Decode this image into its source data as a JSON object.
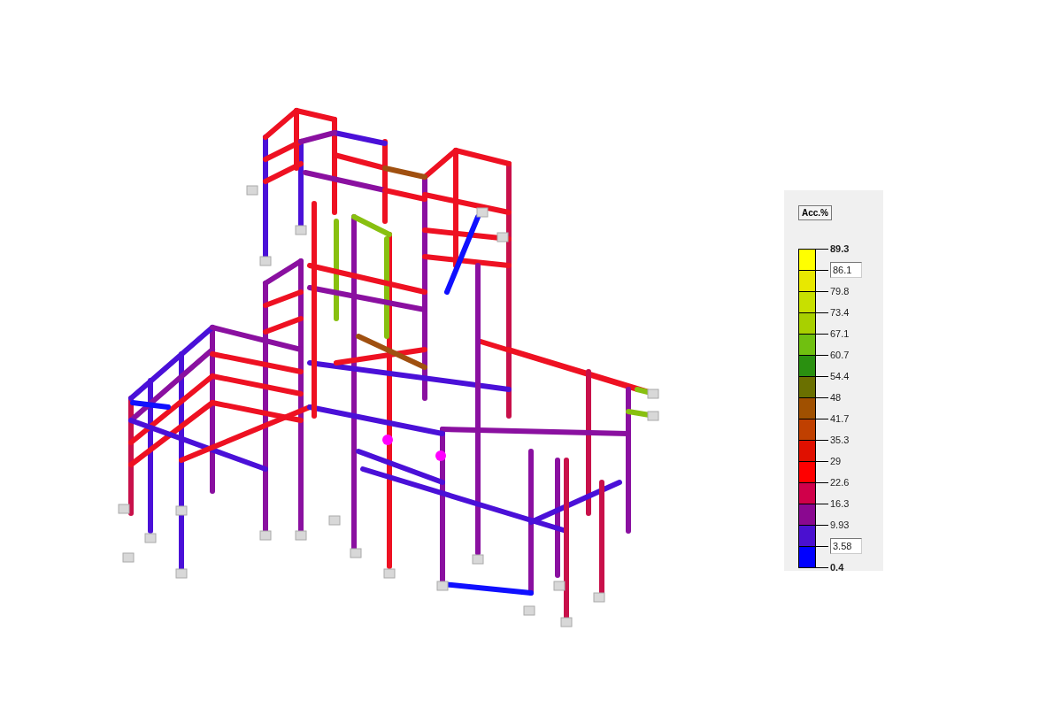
{
  "legend": {
    "title_button": "Acc.%",
    "bands": [
      {
        "color": "#ffff00"
      },
      {
        "color": "#e8e800"
      },
      {
        "color": "#c8e000"
      },
      {
        "color": "#a8d000"
      },
      {
        "color": "#70c010"
      },
      {
        "color": "#2a9010"
      },
      {
        "color": "#6a7000"
      },
      {
        "color": "#a05000"
      },
      {
        "color": "#c04000"
      },
      {
        "color": "#e01000"
      },
      {
        "color": "#ff0000"
      },
      {
        "color": "#d0004a"
      },
      {
        "color": "#8a0890"
      },
      {
        "color": "#4a10d0"
      },
      {
        "color": "#0000ff"
      }
    ],
    "labels": [
      {
        "text": "89.3",
        "kind": "bold"
      },
      {
        "text": "86.1",
        "kind": "input"
      },
      {
        "text": "79.8",
        "kind": "plain"
      },
      {
        "text": "73.4",
        "kind": "plain"
      },
      {
        "text": "67.1",
        "kind": "plain"
      },
      {
        "text": "60.7",
        "kind": "plain"
      },
      {
        "text": "54.4",
        "kind": "plain"
      },
      {
        "text": "48",
        "kind": "plain"
      },
      {
        "text": "41.7",
        "kind": "plain"
      },
      {
        "text": "35.3",
        "kind": "plain"
      },
      {
        "text": "29",
        "kind": "plain"
      },
      {
        "text": "22.6",
        "kind": "plain"
      },
      {
        "text": "16.3",
        "kind": "plain"
      },
      {
        "text": "9.93",
        "kind": "plain"
      },
      {
        "text": "3.58",
        "kind": "input"
      },
      {
        "text": "0.4",
        "kind": "bold"
      }
    ]
  }
}
